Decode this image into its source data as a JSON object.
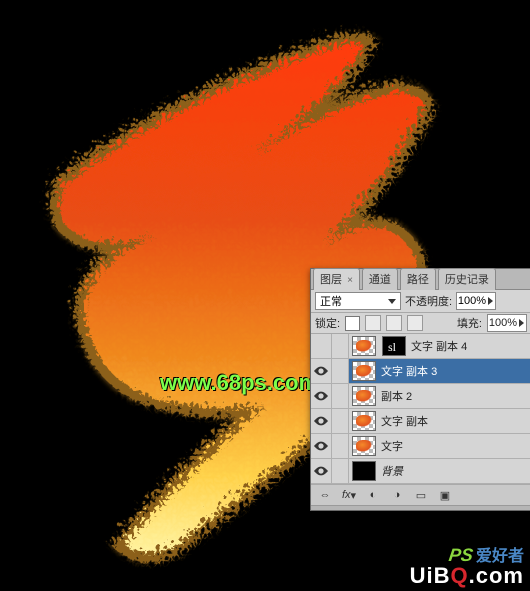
{
  "watermark": "www.68ps.com",
  "brand": {
    "ps": "PS",
    "label": "爱好者",
    "site_a": "UiB",
    "site_b": "Q",
    "site_c": ".com"
  },
  "panel": {
    "tabs": [
      {
        "label": "图层",
        "active": true,
        "closable": true
      },
      {
        "label": "通道"
      },
      {
        "label": "路径"
      },
      {
        "label": "历史记录"
      }
    ],
    "blend_mode": "正常",
    "opacity_label": "不透明度:",
    "opacity_value": "100%",
    "lock_label": "锁定:",
    "fill_label": "填充:",
    "fill_value": "100%",
    "layers": [
      {
        "name": "文字 副本 4",
        "visible": false,
        "hasMask": true,
        "selected": false
      },
      {
        "name": "文字 副本 3",
        "visible": true,
        "hasMask": false,
        "selected": true
      },
      {
        "name": "副本 2",
        "visible": true,
        "hasMask": false,
        "selected": false,
        "partial": true
      },
      {
        "name": "文字 副本",
        "visible": true,
        "hasMask": false,
        "selected": false
      },
      {
        "name": "文字",
        "visible": true,
        "hasMask": false,
        "selected": false
      },
      {
        "name": "背景",
        "visible": true,
        "isBg": true,
        "selected": false,
        "italic": true
      }
    ],
    "foot_icons": [
      "link-icon",
      "fx-icon",
      "mask-icon",
      "adjust-icon",
      "group-icon",
      "new-icon"
    ]
  }
}
